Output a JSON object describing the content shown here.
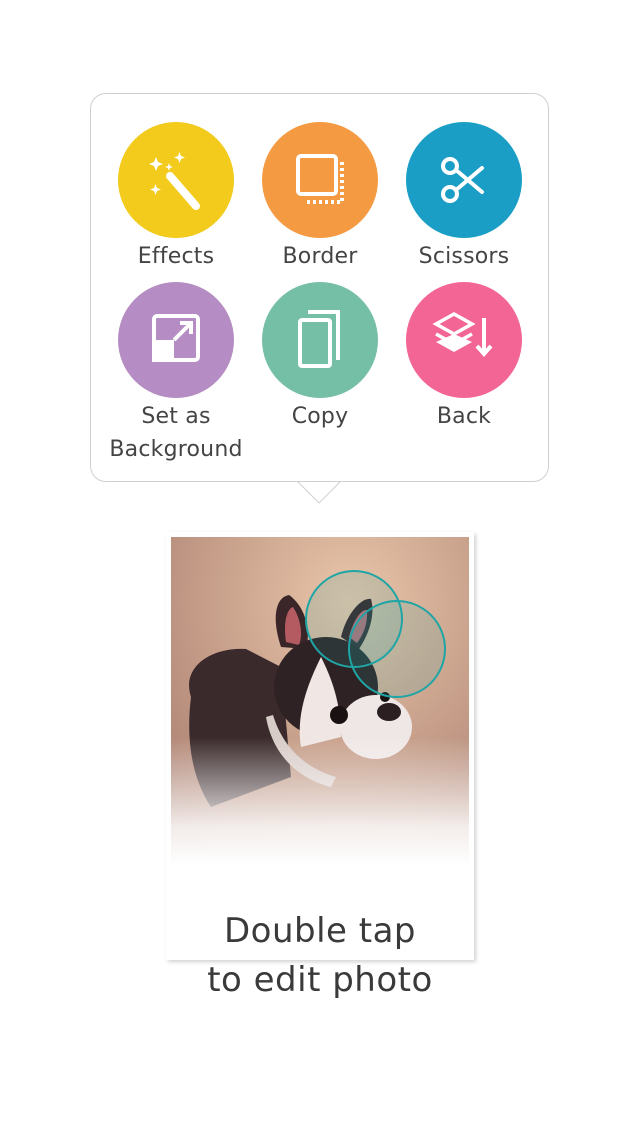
{
  "menu": {
    "items": [
      {
        "label": "Effects",
        "icon": "magic-wand-icon",
        "color": "#f2cb1d"
      },
      {
        "label": "Border",
        "icon": "border-icon",
        "color": "#f49a43"
      },
      {
        "label": "Scissors",
        "icon": "scissors-icon",
        "color": "#1b9ec6"
      },
      {
        "label_line1": "Set as",
        "label_line2": "Background",
        "icon": "set-background-icon",
        "color": "#b58cc3"
      },
      {
        "label": "Copy",
        "icon": "copy-icon",
        "color": "#76bfa7"
      },
      {
        "label": "Back",
        "icon": "send-back-icon",
        "color": "#f26595"
      }
    ]
  },
  "photo": {
    "subject": "dog-photo",
    "overlay_color": "#1fa5a5"
  },
  "caption": {
    "line1": "Double tap",
    "line2": "to edit photo"
  }
}
